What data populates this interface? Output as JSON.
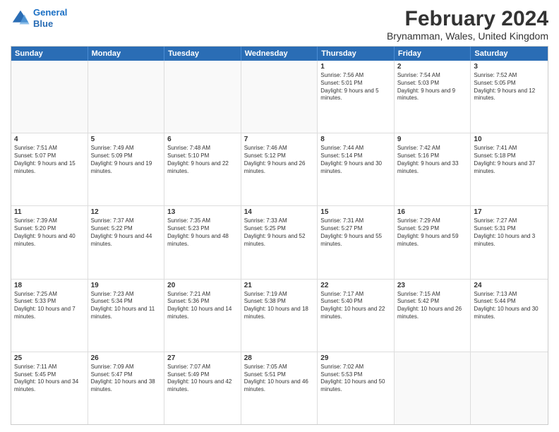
{
  "header": {
    "logo_line1": "General",
    "logo_line2": "Blue",
    "title": "February 2024",
    "subtitle": "Brynamman, Wales, United Kingdom"
  },
  "days": [
    "Sunday",
    "Monday",
    "Tuesday",
    "Wednesday",
    "Thursday",
    "Friday",
    "Saturday"
  ],
  "weeks": [
    [
      {
        "day": "",
        "sunrise": "",
        "sunset": "",
        "daylight": "",
        "empty": true
      },
      {
        "day": "",
        "sunrise": "",
        "sunset": "",
        "daylight": "",
        "empty": true
      },
      {
        "day": "",
        "sunrise": "",
        "sunset": "",
        "daylight": "",
        "empty": true
      },
      {
        "day": "",
        "sunrise": "",
        "sunset": "",
        "daylight": "",
        "empty": true
      },
      {
        "day": "1",
        "sunrise": "Sunrise: 7:56 AM",
        "sunset": "Sunset: 5:01 PM",
        "daylight": "Daylight: 9 hours and 5 minutes."
      },
      {
        "day": "2",
        "sunrise": "Sunrise: 7:54 AM",
        "sunset": "Sunset: 5:03 PM",
        "daylight": "Daylight: 9 hours and 9 minutes."
      },
      {
        "day": "3",
        "sunrise": "Sunrise: 7:52 AM",
        "sunset": "Sunset: 5:05 PM",
        "daylight": "Daylight: 9 hours and 12 minutes."
      }
    ],
    [
      {
        "day": "4",
        "sunrise": "Sunrise: 7:51 AM",
        "sunset": "Sunset: 5:07 PM",
        "daylight": "Daylight: 9 hours and 15 minutes."
      },
      {
        "day": "5",
        "sunrise": "Sunrise: 7:49 AM",
        "sunset": "Sunset: 5:09 PM",
        "daylight": "Daylight: 9 hours and 19 minutes."
      },
      {
        "day": "6",
        "sunrise": "Sunrise: 7:48 AM",
        "sunset": "Sunset: 5:10 PM",
        "daylight": "Daylight: 9 hours and 22 minutes."
      },
      {
        "day": "7",
        "sunrise": "Sunrise: 7:46 AM",
        "sunset": "Sunset: 5:12 PM",
        "daylight": "Daylight: 9 hours and 26 minutes."
      },
      {
        "day": "8",
        "sunrise": "Sunrise: 7:44 AM",
        "sunset": "Sunset: 5:14 PM",
        "daylight": "Daylight: 9 hours and 30 minutes."
      },
      {
        "day": "9",
        "sunrise": "Sunrise: 7:42 AM",
        "sunset": "Sunset: 5:16 PM",
        "daylight": "Daylight: 9 hours and 33 minutes."
      },
      {
        "day": "10",
        "sunrise": "Sunrise: 7:41 AM",
        "sunset": "Sunset: 5:18 PM",
        "daylight": "Daylight: 9 hours and 37 minutes."
      }
    ],
    [
      {
        "day": "11",
        "sunrise": "Sunrise: 7:39 AM",
        "sunset": "Sunset: 5:20 PM",
        "daylight": "Daylight: 9 hours and 40 minutes."
      },
      {
        "day": "12",
        "sunrise": "Sunrise: 7:37 AM",
        "sunset": "Sunset: 5:22 PM",
        "daylight": "Daylight: 9 hours and 44 minutes."
      },
      {
        "day": "13",
        "sunrise": "Sunrise: 7:35 AM",
        "sunset": "Sunset: 5:23 PM",
        "daylight": "Daylight: 9 hours and 48 minutes."
      },
      {
        "day": "14",
        "sunrise": "Sunrise: 7:33 AM",
        "sunset": "Sunset: 5:25 PM",
        "daylight": "Daylight: 9 hours and 52 minutes."
      },
      {
        "day": "15",
        "sunrise": "Sunrise: 7:31 AM",
        "sunset": "Sunset: 5:27 PM",
        "daylight": "Daylight: 9 hours and 55 minutes."
      },
      {
        "day": "16",
        "sunrise": "Sunrise: 7:29 AM",
        "sunset": "Sunset: 5:29 PM",
        "daylight": "Daylight: 9 hours and 59 minutes."
      },
      {
        "day": "17",
        "sunrise": "Sunrise: 7:27 AM",
        "sunset": "Sunset: 5:31 PM",
        "daylight": "Daylight: 10 hours and 3 minutes."
      }
    ],
    [
      {
        "day": "18",
        "sunrise": "Sunrise: 7:25 AM",
        "sunset": "Sunset: 5:33 PM",
        "daylight": "Daylight: 10 hours and 7 minutes."
      },
      {
        "day": "19",
        "sunrise": "Sunrise: 7:23 AM",
        "sunset": "Sunset: 5:34 PM",
        "daylight": "Daylight: 10 hours and 11 minutes."
      },
      {
        "day": "20",
        "sunrise": "Sunrise: 7:21 AM",
        "sunset": "Sunset: 5:36 PM",
        "daylight": "Daylight: 10 hours and 14 minutes."
      },
      {
        "day": "21",
        "sunrise": "Sunrise: 7:19 AM",
        "sunset": "Sunset: 5:38 PM",
        "daylight": "Daylight: 10 hours and 18 minutes."
      },
      {
        "day": "22",
        "sunrise": "Sunrise: 7:17 AM",
        "sunset": "Sunset: 5:40 PM",
        "daylight": "Daylight: 10 hours and 22 minutes."
      },
      {
        "day": "23",
        "sunrise": "Sunrise: 7:15 AM",
        "sunset": "Sunset: 5:42 PM",
        "daylight": "Daylight: 10 hours and 26 minutes."
      },
      {
        "day": "24",
        "sunrise": "Sunrise: 7:13 AM",
        "sunset": "Sunset: 5:44 PM",
        "daylight": "Daylight: 10 hours and 30 minutes."
      }
    ],
    [
      {
        "day": "25",
        "sunrise": "Sunrise: 7:11 AM",
        "sunset": "Sunset: 5:45 PM",
        "daylight": "Daylight: 10 hours and 34 minutes."
      },
      {
        "day": "26",
        "sunrise": "Sunrise: 7:09 AM",
        "sunset": "Sunset: 5:47 PM",
        "daylight": "Daylight: 10 hours and 38 minutes."
      },
      {
        "day": "27",
        "sunrise": "Sunrise: 7:07 AM",
        "sunset": "Sunset: 5:49 PM",
        "daylight": "Daylight: 10 hours and 42 minutes."
      },
      {
        "day": "28",
        "sunrise": "Sunrise: 7:05 AM",
        "sunset": "Sunset: 5:51 PM",
        "daylight": "Daylight: 10 hours and 46 minutes."
      },
      {
        "day": "29",
        "sunrise": "Sunrise: 7:02 AM",
        "sunset": "Sunset: 5:53 PM",
        "daylight": "Daylight: 10 hours and 50 minutes."
      },
      {
        "day": "",
        "sunrise": "",
        "sunset": "",
        "daylight": "",
        "empty": true
      },
      {
        "day": "",
        "sunrise": "",
        "sunset": "",
        "daylight": "",
        "empty": true
      }
    ]
  ]
}
